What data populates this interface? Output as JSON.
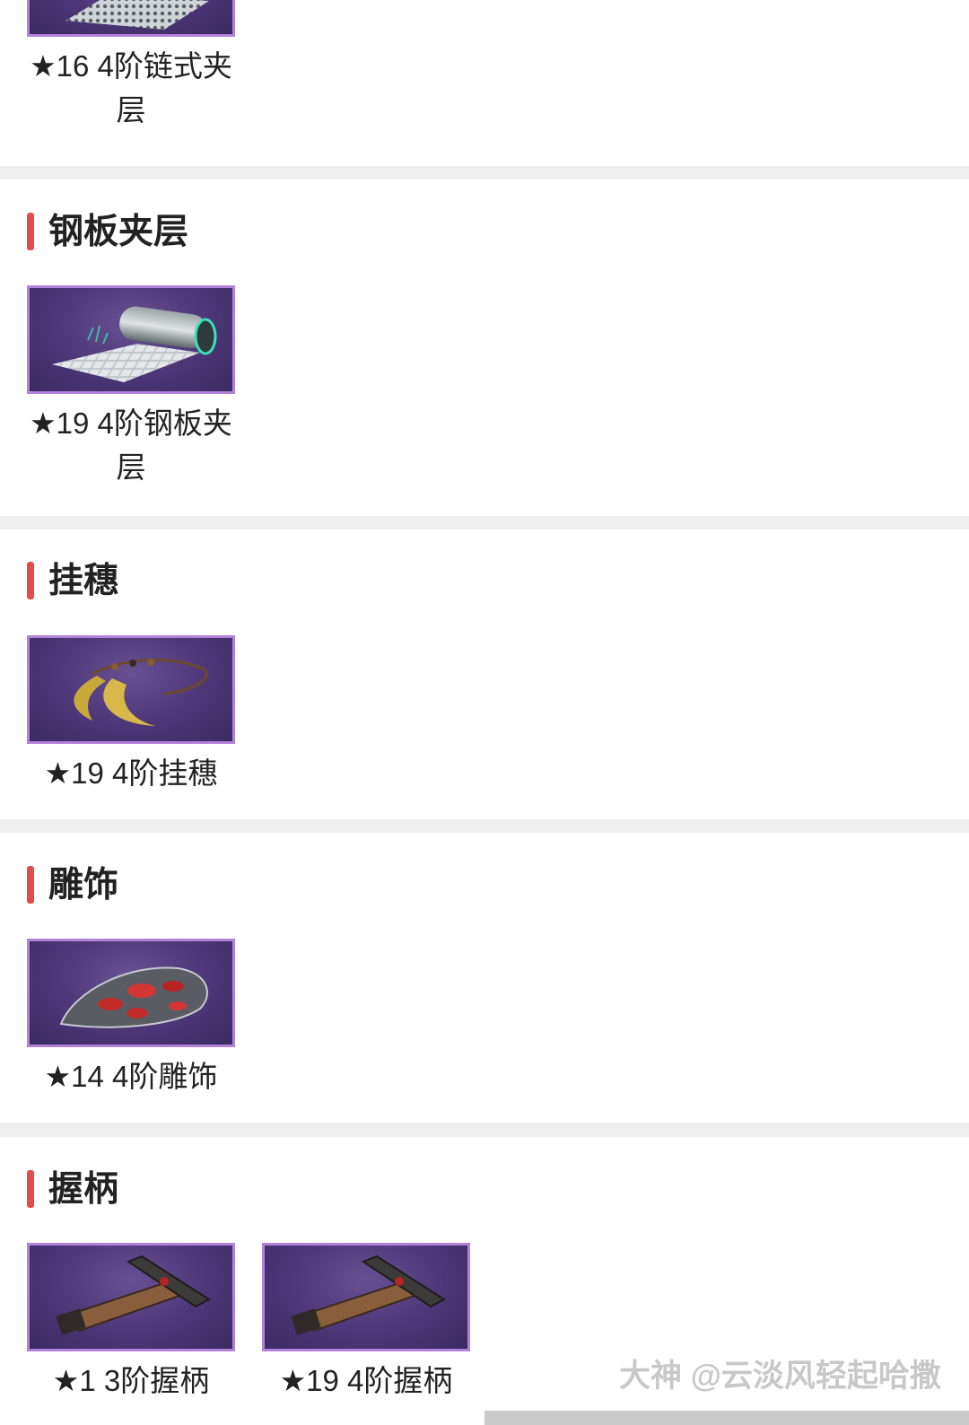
{
  "top_item": {
    "label": "★16 4阶链式夹层",
    "icon": "chain-mail-layer"
  },
  "sections": [
    {
      "title": "钢板夹层",
      "items": [
        {
          "label": "★19 4阶钢板夹层",
          "icon": "steel-plate-roll"
        }
      ]
    },
    {
      "title": "挂穗",
      "items": [
        {
          "label": "★19 4阶挂穗",
          "icon": "tassel"
        }
      ]
    },
    {
      "title": "雕饰",
      "items": [
        {
          "label": "★14 4阶雕饰",
          "icon": "carving"
        }
      ]
    },
    {
      "title": "握柄",
      "items": [
        {
          "label": "★1 3阶握柄",
          "icon": "grip"
        },
        {
          "label": "★19 4阶握柄",
          "icon": "grip"
        }
      ]
    }
  ],
  "watermark": "大神 @云淡风轻起哈撒",
  "colors": {
    "accent": "#e64b4b",
    "tab_indicator": "#e6393b",
    "thumb_border": "#b082d8",
    "thumb_bg": "#4c3677"
  }
}
